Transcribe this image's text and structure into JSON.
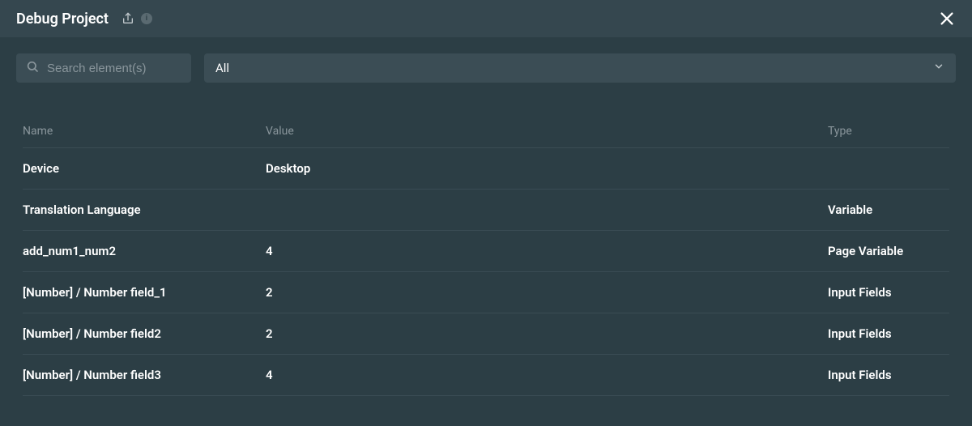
{
  "header": {
    "title": "Debug Project",
    "info_badge": "i"
  },
  "search": {
    "placeholder": "Search element(s)",
    "value": ""
  },
  "filter": {
    "selected": "All"
  },
  "columns": {
    "name": "Name",
    "value": "Value",
    "type": "Type"
  },
  "rows": [
    {
      "name": "Device",
      "value": "Desktop",
      "type": ""
    },
    {
      "name": "Translation Language",
      "value": "",
      "type": "Variable"
    },
    {
      "name": "add_num1_num2",
      "value": "4",
      "type": "Page Variable"
    },
    {
      "name": "[Number]  / Number field_1",
      "value": "2",
      "type": "Input Fields"
    },
    {
      "name": "[Number]  / Number field2",
      "value": "2",
      "type": "Input Fields"
    },
    {
      "name": "[Number]  / Number field3",
      "value": "4",
      "type": "Input Fields"
    }
  ]
}
